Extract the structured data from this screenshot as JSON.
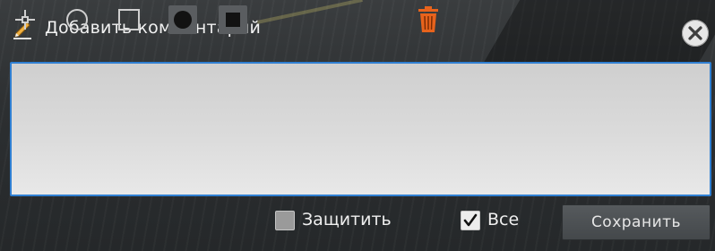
{
  "header": {
    "title": "Добавить комментарий",
    "icon": "pencil-icon",
    "close_icon": "close-icon"
  },
  "comment": {
    "value": "",
    "placeholder": ""
  },
  "toolbar": {
    "tools": [
      {
        "icon": "crosshair-icon"
      },
      {
        "icon": "circle-outline-icon"
      },
      {
        "icon": "square-outline-icon"
      },
      {
        "icon": "circle-filled-icon"
      },
      {
        "icon": "square-filled-icon"
      }
    ],
    "protect_label": "Защитить",
    "protect_checked": false,
    "delete_icon": "trash-icon",
    "all_label": "Все",
    "all_checked": true,
    "save_label": "Сохранить"
  },
  "colors": {
    "accent": "#2f7fd2",
    "delete": "#e8631c"
  }
}
